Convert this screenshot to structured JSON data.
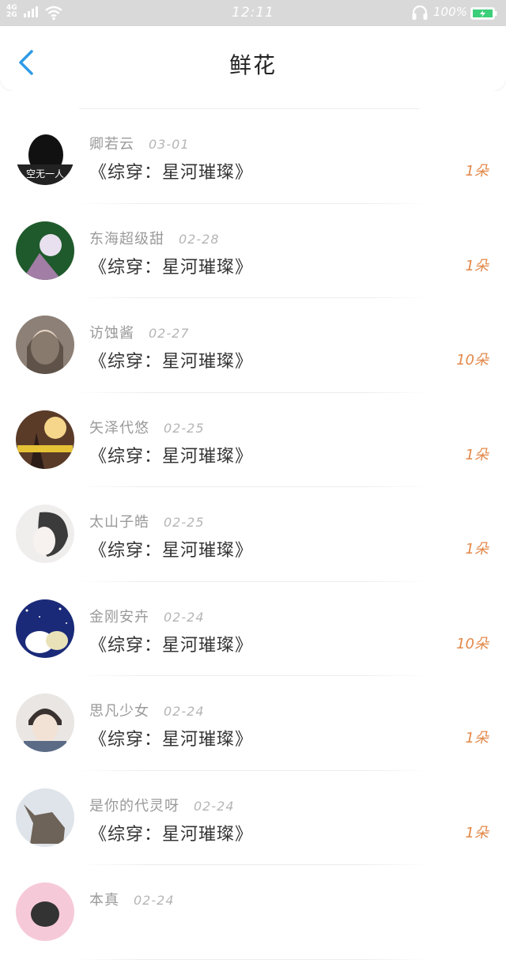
{
  "status_bar": {
    "signal_label_top": "4G",
    "signal_label_bottom": "2G",
    "time": "12:11",
    "battery": "100%"
  },
  "header": {
    "title": "鲜花",
    "back_icon": "chevron-left-icon"
  },
  "colors": {
    "accent": "#2f9be8",
    "count": "#e3884a"
  },
  "items": [
    {
      "name": "卿若云",
      "date": "03-01",
      "book": "《综穿：星河璀璨》",
      "count": "1朵"
    },
    {
      "name": "东海超级甜",
      "date": "02-28",
      "book": "《综穿：星河璀璨》",
      "count": "1朵"
    },
    {
      "name": "访蚀酱",
      "date": "02-27",
      "book": "《综穿：星河璀璨》",
      "count": "10朵"
    },
    {
      "name": "矢泽代悠",
      "date": "02-25",
      "book": "《综穿：星河璀璨》",
      "count": "1朵"
    },
    {
      "name": "太山子皓",
      "date": "02-25",
      "book": "《综穿：星河璀璨》",
      "count": "1朵"
    },
    {
      "name": "金刚安卉",
      "date": "02-24",
      "book": "《综穿：星河璀璨》",
      "count": "10朵"
    },
    {
      "name": "思凡少女",
      "date": "02-24",
      "book": "《综穿：星河璀璨》",
      "count": "1朵"
    },
    {
      "name": "是你的代灵呀",
      "date": "02-24",
      "book": "《综穿：星河璀璨》",
      "count": "1朵"
    },
    {
      "name": "本真",
      "date": "02-24",
      "book": "",
      "count": ""
    }
  ],
  "avatar_badges": [
    "空无一人",
    "",
    "",
    "",
    "",
    "",
    "",
    "",
    ""
  ]
}
